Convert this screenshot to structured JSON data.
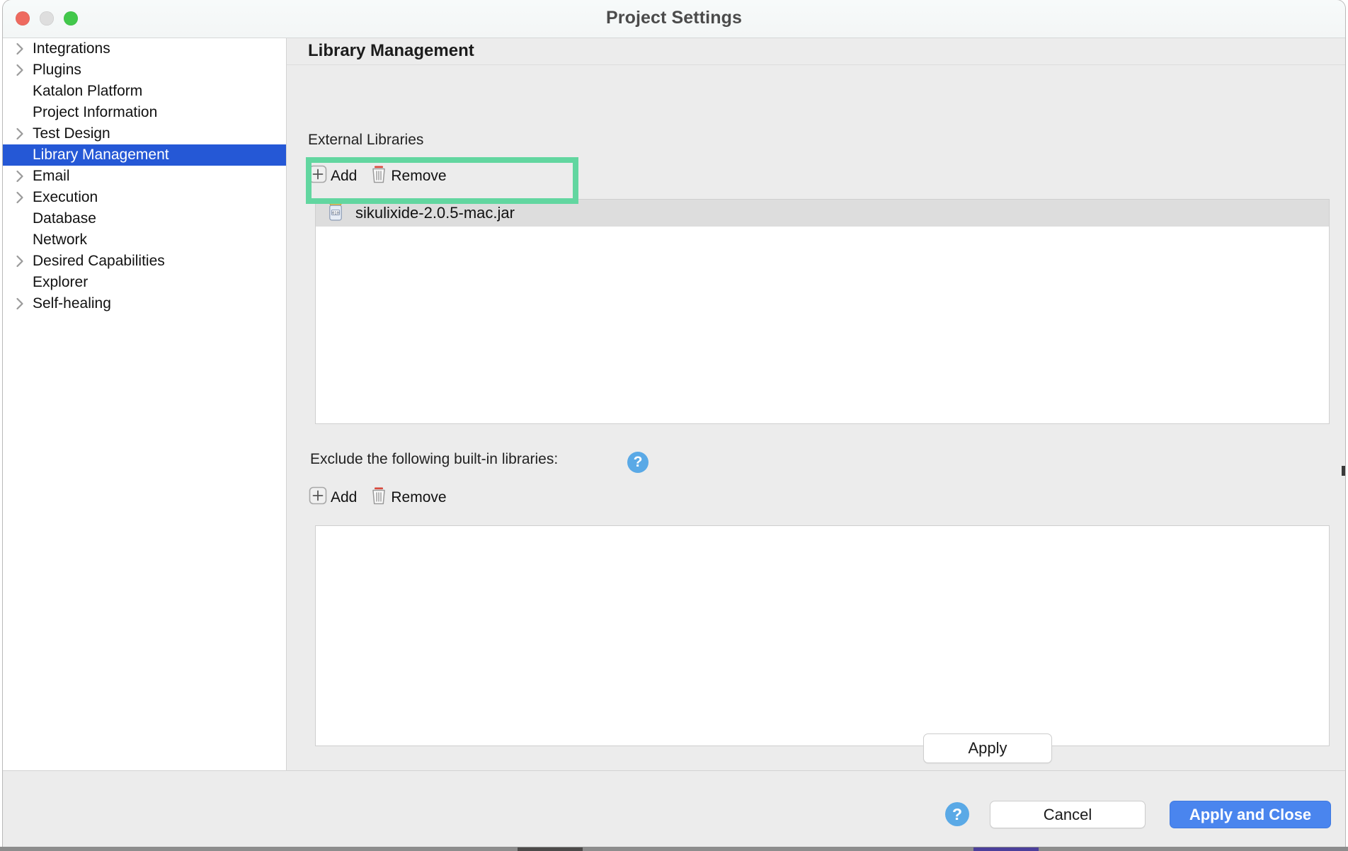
{
  "window": {
    "title": "Project Settings",
    "traffic_lights": [
      {
        "name": "close",
        "color": "#ee6a5f"
      },
      {
        "name": "minimize",
        "color": "#dedede"
      },
      {
        "name": "maximize",
        "color": "#42c84b"
      }
    ]
  },
  "sidebar": {
    "items": [
      {
        "label": "Integrations",
        "expandable": true,
        "selected": false
      },
      {
        "label": "Plugins",
        "expandable": true,
        "selected": false
      },
      {
        "label": "Katalon Platform",
        "expandable": false,
        "selected": false
      },
      {
        "label": "Project Information",
        "expandable": false,
        "selected": false
      },
      {
        "label": "Test Design",
        "expandable": true,
        "selected": false
      },
      {
        "label": "Library Management",
        "expandable": false,
        "selected": true
      },
      {
        "label": "Email",
        "expandable": true,
        "selected": false
      },
      {
        "label": "Execution",
        "expandable": true,
        "selected": false
      },
      {
        "label": "Database",
        "expandable": false,
        "selected": false
      },
      {
        "label": "Network",
        "expandable": false,
        "selected": false
      },
      {
        "label": "Desired Capabilities",
        "expandable": true,
        "selected": false
      },
      {
        "label": "Explorer",
        "expandable": false,
        "selected": false
      },
      {
        "label": "Self-healing",
        "expandable": true,
        "selected": false
      }
    ]
  },
  "content": {
    "pane_title": "Library Management",
    "external": {
      "label": "External Libraries",
      "add_label": "Add",
      "remove_label": "Remove",
      "rows": [
        {
          "name": "sikulixide-2.0.5-mac.jar",
          "selected": true,
          "icon": "jar-file-icon"
        }
      ]
    },
    "exclude": {
      "label": "Exclude the following built-in libraries:",
      "help_icon": "help-question-icon",
      "add_label": "Add",
      "remove_label": "Remove",
      "rows": []
    },
    "apply_label": "Apply"
  },
  "footer": {
    "help_icon": "help-question-icon",
    "cancel_label": "Cancel",
    "apply_close_label": "Apply and Close"
  },
  "annotation": {
    "highlight_color": "#62d6a0",
    "target": "sikulixide-2.0.5-mac.jar"
  },
  "colors": {
    "selection_blue": "#2558d6",
    "primary_button": "#4a85ee",
    "window_chrome": "#ececec",
    "list_selected_row": "#dddddd",
    "help_blue": "#5aa9e6"
  }
}
